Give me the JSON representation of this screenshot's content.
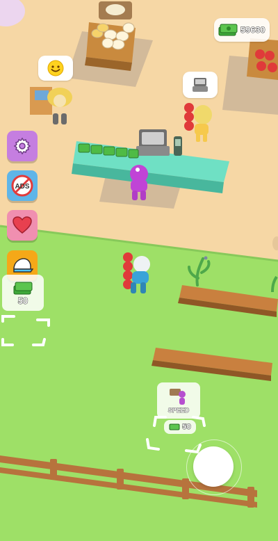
{
  "hud": {
    "money": "59630",
    "money_icon": "cash-icon"
  },
  "side_menu": [
    {
      "name": "settings-button",
      "icon": "gear-icon",
      "color": "#c57ee0"
    },
    {
      "name": "no-ads-button",
      "icon": "no-ads-icon",
      "label": "ADS",
      "color": "#5fb5e8"
    },
    {
      "name": "favorites-button",
      "icon": "heart-icon",
      "color": "#f08fb0"
    },
    {
      "name": "cap-button",
      "icon": "cap-icon",
      "color": "#f5a818"
    }
  ],
  "upgrade_spot_left": {
    "cost": "50"
  },
  "speed_upgrade": {
    "label": "SPEED",
    "cost": "50"
  },
  "speech_bubbles": {
    "customer_emoji": "smile-emoji-icon",
    "cashier_icon": "cash-register-icon"
  },
  "colors": {
    "sand": "#f6d7a5",
    "grass": "#9ee067",
    "counter": "#6fe0c4",
    "fence": "#b7733d"
  }
}
